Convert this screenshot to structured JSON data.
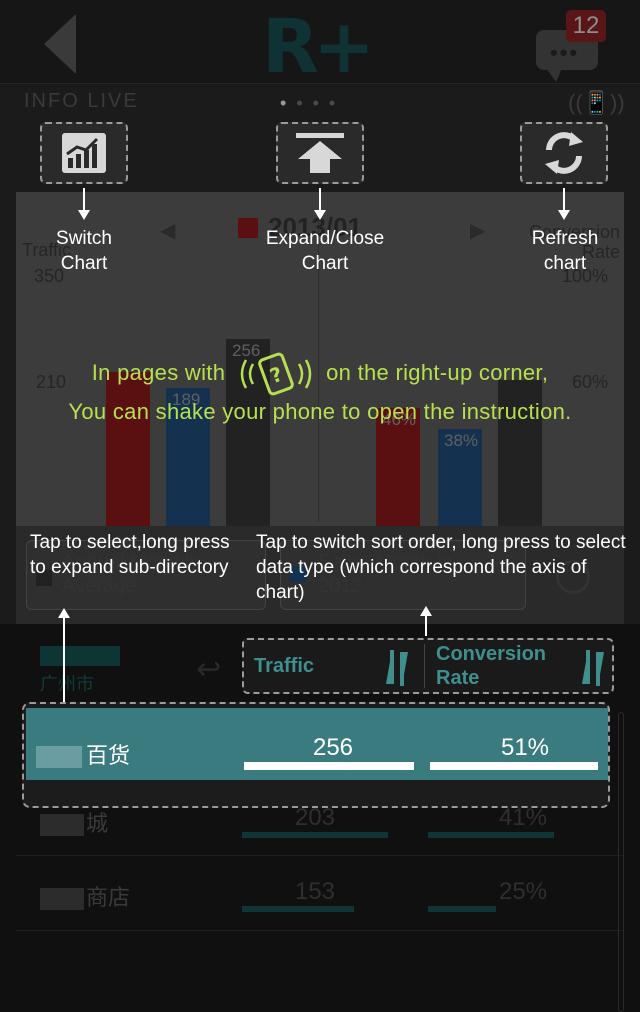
{
  "app": {
    "logo_text": "R+",
    "message_badge": "12",
    "section_title": "INFO LIVE",
    "chart_header": {
      "title": "2013/01",
      "left_axis_title": "Traffic",
      "left_axis_ticks": [
        "350",
        "210"
      ],
      "right_axis_title": "Conversion Rate",
      "right_axis_ticks": [
        "100%",
        "60%"
      ],
      "left_bars": [
        {
          "label": "",
          "value": 210,
          "color": "#5a1010"
        },
        {
          "label": "189",
          "value": 189,
          "color": "#14324f"
        },
        {
          "label": "256",
          "value": 256,
          "color": "#222222"
        }
      ],
      "right_bars": [
        {
          "label": "46%",
          "value": 46,
          "color": "#5a1010"
        },
        {
          "label": "38%",
          "value": 38,
          "color": "#14324f"
        },
        {
          "label": "",
          "value": 57,
          "color": "#222222"
        }
      ]
    },
    "controls": {
      "left_select": "Annual Monthly Average",
      "right_select": "Same Month in 2012"
    },
    "city": "广州市",
    "columns": {
      "traffic": "Traffic",
      "conversion": "Conversion Rate"
    },
    "rows": [
      {
        "name": "百货",
        "traffic": "256",
        "conversion": "51%",
        "traffic_frac": 1.0,
        "conv_frac": 1.0
      },
      {
        "name": "城",
        "traffic": "203",
        "conversion": "41%",
        "traffic_frac": 0.79,
        "conv_frac": 0.8
      },
      {
        "name": "商店",
        "traffic": "153",
        "conversion": "25%",
        "traffic_frac": 0.6,
        "conv_frac": 0.49
      }
    ]
  },
  "overlay": {
    "switch_chart": "Switch Chart",
    "expand_close_chart": "Expand/Close Chart",
    "refresh_chart": "Refresh chart",
    "shake_line1_before": "In pages with",
    "shake_line1_after": "on the right-up corner,",
    "shake_line2": "You can shake your phone to open the instruction.",
    "tap_select": "Tap to select,long press to expand sub-directory",
    "tap_sort": "Tap to switch sort order, long press to select data type (which correspond the axis of chart)"
  },
  "colors": {
    "accent": "#b7e04f",
    "teal": "#3a7b80",
    "teal_text": "#3f8f8f",
    "badge": "#5a1616"
  },
  "icons": [
    "back-arrow-icon",
    "chat-icon",
    "shake-phone-icon",
    "chart-switch-icon",
    "expand-collapse-icon",
    "refresh-icon",
    "sort-icon",
    "zoom-icon",
    "undo-arrow-icon"
  ]
}
